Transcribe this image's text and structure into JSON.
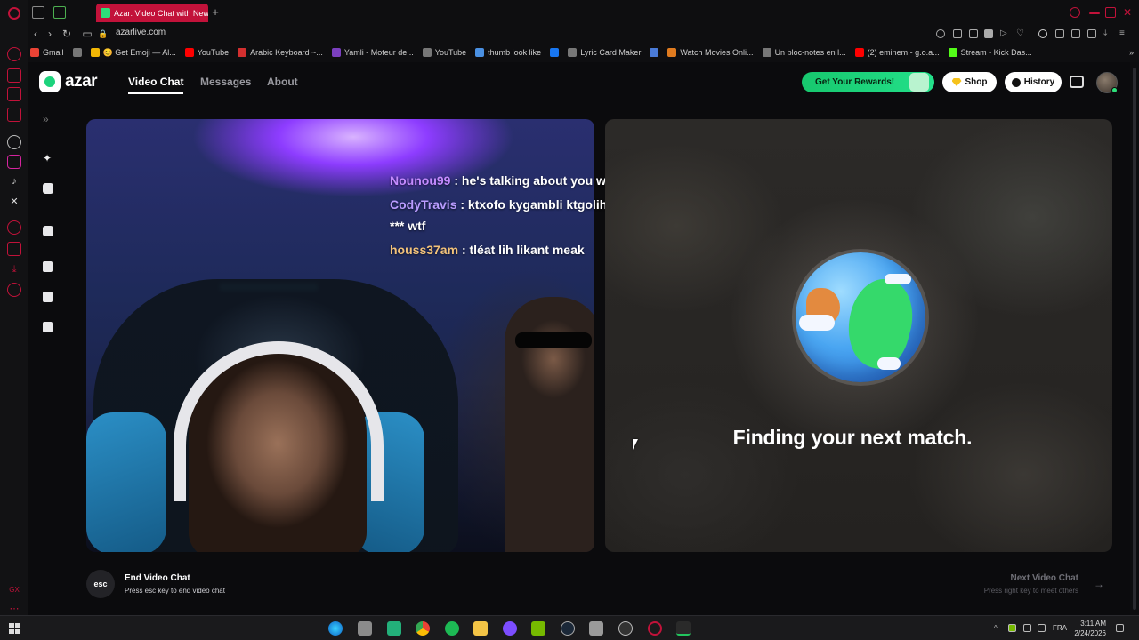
{
  "browser": {
    "active_tab_title": "Azar: Video Chat with New",
    "url": "azarlive.com",
    "bookmarks": [
      {
        "label": "Gmail",
        "color": "#ea4335"
      },
      {
        "label": "",
        "color": "#777777"
      },
      {
        "label": "😊 Get Emoji — Al...",
        "color": "#f2b705"
      },
      {
        "label": "YouTube",
        "color": "#ff0000"
      },
      {
        "label": "Arabic Keyboard ~...",
        "color": "#d32f2f"
      },
      {
        "label": "Yamli - Moteur de...",
        "color": "#7b3fbf"
      },
      {
        "label": "YouTube",
        "color": "#777777"
      },
      {
        "label": "thumb look like",
        "color": "#4a90e2"
      },
      {
        "label": "",
        "color": "#1877f2"
      },
      {
        "label": "Lyric Card Maker",
        "color": "#777777"
      },
      {
        "label": "",
        "color": "#4a7bd8"
      },
      {
        "label": "Watch Movies Onli...",
        "color": "#e07b1f"
      },
      {
        "label": "Un bloc-notes en l...",
        "color": "#777777"
      },
      {
        "label": "(2) eminem - g.o.a...",
        "color": "#ff0000"
      },
      {
        "label": "Stream - Kick Das...",
        "color": "#53fc18"
      }
    ]
  },
  "app": {
    "logo_text": "azar",
    "nav": {
      "video_chat": "Video Chat",
      "messages": "Messages",
      "about": "About"
    },
    "rewards_label": "Get Your Rewards!",
    "shop_label": "Shop",
    "history_label": "History",
    "colors": {
      "brand_green": "#1cd37c"
    }
  },
  "chat": [
    {
      "user": "Nounou99",
      "user_color": "#c58bff",
      "message": ": he's talking about you with that girl"
    },
    {
      "user": "CodyTravis",
      "user_color": "#b99cff",
      "message": ": ktxofo kygambli ktgolih ilyass ola *** wtf"
    },
    {
      "user": "houss37am",
      "user_color": "#f2c27a",
      "message": ": tléat lih likant meak"
    }
  ],
  "match": {
    "status_text": "Finding your next match."
  },
  "footer": {
    "esc_label": "esc",
    "end_title": "End Video Chat",
    "end_subtitle": "Press esc key to end video chat",
    "next_title": "Next Video Chat",
    "next_subtitle": "Press right key to meet others",
    "next_arrow": "→"
  },
  "taskbar": {
    "language": "FRA",
    "time": "3:11 AM",
    "date": "2/24/2026"
  }
}
